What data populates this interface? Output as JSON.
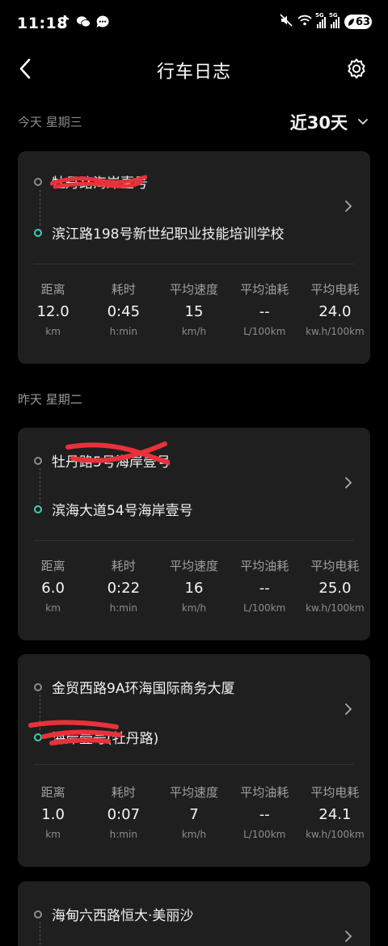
{
  "status_bar": {
    "time": "11:18",
    "battery": "63",
    "signal1_label": "5G",
    "signal2_label": "5G"
  },
  "header": {
    "title": "行车日志",
    "back_icon": "chevron-left-icon",
    "settings_icon": "gear-icon"
  },
  "filter": {
    "today_label": "今天 星期三",
    "range": "近30天"
  },
  "sections": [
    {
      "date": "昨天 星期二"
    }
  ],
  "trips": [
    {
      "start": "牡丹路海岸壹号",
      "end": "滨江路198号新世纪职业技能培训学校",
      "stats": [
        {
          "label": "距离",
          "value": "12.0",
          "unit": "km"
        },
        {
          "label": "耗时",
          "value": "0:45",
          "unit": "h:min"
        },
        {
          "label": "平均速度",
          "value": "15",
          "unit": "km/h"
        },
        {
          "label": "平均油耗",
          "value": "--",
          "unit": "L/100km"
        },
        {
          "label": "平均电耗",
          "value": "24.0",
          "unit": "kw.h/100km"
        }
      ]
    },
    {
      "start": "牡丹路5号海岸壹号",
      "end": "滨海大道54号海岸壹号",
      "stats": [
        {
          "label": "距离",
          "value": "6.0",
          "unit": "km"
        },
        {
          "label": "耗时",
          "value": "0:22",
          "unit": "h:min"
        },
        {
          "label": "平均速度",
          "value": "16",
          "unit": "km/h"
        },
        {
          "label": "平均油耗",
          "value": "--",
          "unit": "L/100km"
        },
        {
          "label": "平均电耗",
          "value": "25.0",
          "unit": "kw.h/100km"
        }
      ]
    },
    {
      "start": "金贸西路9A环海国际商务大厦",
      "end": "海岸壹号(牡丹路)",
      "stats": [
        {
          "label": "距离",
          "value": "1.0",
          "unit": "km"
        },
        {
          "label": "耗时",
          "value": "0:07",
          "unit": "h:min"
        },
        {
          "label": "平均速度",
          "value": "7",
          "unit": "km/h"
        },
        {
          "label": "平均油耗",
          "value": "--",
          "unit": "L/100km"
        },
        {
          "label": "平均电耗",
          "value": "24.1",
          "unit": "kw.h/100km"
        }
      ]
    },
    {
      "start": "海甸六西路恒大·美丽沙"
    }
  ],
  "colors": {
    "background": "#000000",
    "card": "#1f1f1f",
    "end_dot": "#3ad2b2",
    "redaction": "#e8323a"
  }
}
